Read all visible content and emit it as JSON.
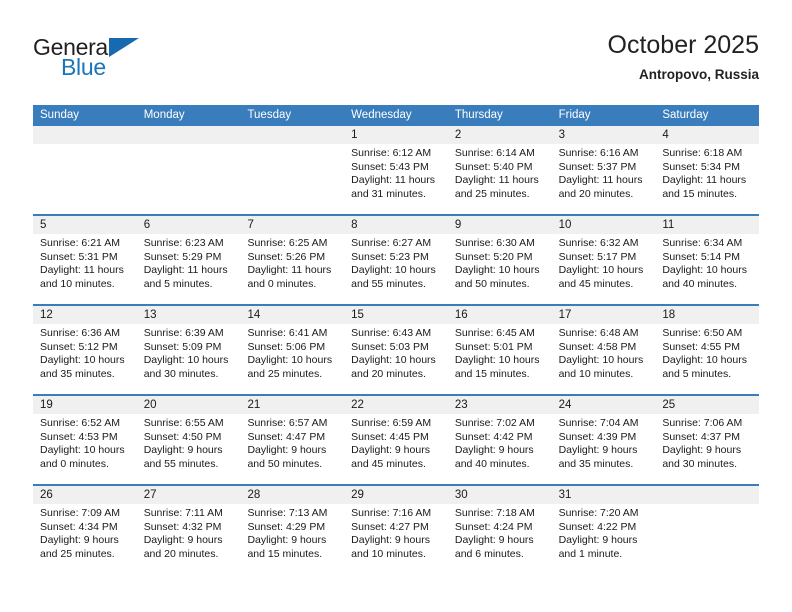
{
  "logo": {
    "text_top": "General",
    "text_bottom": "Blue",
    "triangle_color": "#1769b0",
    "blue_color": "#1b75bb"
  },
  "header": {
    "title": "October 2025",
    "subtitle": "Antropovo, Russia"
  },
  "theme": {
    "header_blue": "#3a7dbd",
    "daynum_band": "#f0f0f0"
  },
  "calendar": {
    "weekday_headers": [
      "Sunday",
      "Monday",
      "Tuesday",
      "Wednesday",
      "Thursday",
      "Friday",
      "Saturday"
    ],
    "weeks": [
      [
        {
          "day": "",
          "sunrise": "",
          "sunset": "",
          "daylight_a": "",
          "daylight_b": ""
        },
        {
          "day": "",
          "sunrise": "",
          "sunset": "",
          "daylight_a": "",
          "daylight_b": ""
        },
        {
          "day": "",
          "sunrise": "",
          "sunset": "",
          "daylight_a": "",
          "daylight_b": ""
        },
        {
          "day": "1",
          "sunrise": "Sunrise: 6:12 AM",
          "sunset": "Sunset: 5:43 PM",
          "daylight_a": "Daylight: 11 hours",
          "daylight_b": "and 31 minutes."
        },
        {
          "day": "2",
          "sunrise": "Sunrise: 6:14 AM",
          "sunset": "Sunset: 5:40 PM",
          "daylight_a": "Daylight: 11 hours",
          "daylight_b": "and 25 minutes."
        },
        {
          "day": "3",
          "sunrise": "Sunrise: 6:16 AM",
          "sunset": "Sunset: 5:37 PM",
          "daylight_a": "Daylight: 11 hours",
          "daylight_b": "and 20 minutes."
        },
        {
          "day": "4",
          "sunrise": "Sunrise: 6:18 AM",
          "sunset": "Sunset: 5:34 PM",
          "daylight_a": "Daylight: 11 hours",
          "daylight_b": "and 15 minutes."
        }
      ],
      [
        {
          "day": "5",
          "sunrise": "Sunrise: 6:21 AM",
          "sunset": "Sunset: 5:31 PM",
          "daylight_a": "Daylight: 11 hours",
          "daylight_b": "and 10 minutes."
        },
        {
          "day": "6",
          "sunrise": "Sunrise: 6:23 AM",
          "sunset": "Sunset: 5:29 PM",
          "daylight_a": "Daylight: 11 hours",
          "daylight_b": "and 5 minutes."
        },
        {
          "day": "7",
          "sunrise": "Sunrise: 6:25 AM",
          "sunset": "Sunset: 5:26 PM",
          "daylight_a": "Daylight: 11 hours",
          "daylight_b": "and 0 minutes."
        },
        {
          "day": "8",
          "sunrise": "Sunrise: 6:27 AM",
          "sunset": "Sunset: 5:23 PM",
          "daylight_a": "Daylight: 10 hours",
          "daylight_b": "and 55 minutes."
        },
        {
          "day": "9",
          "sunrise": "Sunrise: 6:30 AM",
          "sunset": "Sunset: 5:20 PM",
          "daylight_a": "Daylight: 10 hours",
          "daylight_b": "and 50 minutes."
        },
        {
          "day": "10",
          "sunrise": "Sunrise: 6:32 AM",
          "sunset": "Sunset: 5:17 PM",
          "daylight_a": "Daylight: 10 hours",
          "daylight_b": "and 45 minutes."
        },
        {
          "day": "11",
          "sunrise": "Sunrise: 6:34 AM",
          "sunset": "Sunset: 5:14 PM",
          "daylight_a": "Daylight: 10 hours",
          "daylight_b": "and 40 minutes."
        }
      ],
      [
        {
          "day": "12",
          "sunrise": "Sunrise: 6:36 AM",
          "sunset": "Sunset: 5:12 PM",
          "daylight_a": "Daylight: 10 hours",
          "daylight_b": "and 35 minutes."
        },
        {
          "day": "13",
          "sunrise": "Sunrise: 6:39 AM",
          "sunset": "Sunset: 5:09 PM",
          "daylight_a": "Daylight: 10 hours",
          "daylight_b": "and 30 minutes."
        },
        {
          "day": "14",
          "sunrise": "Sunrise: 6:41 AM",
          "sunset": "Sunset: 5:06 PM",
          "daylight_a": "Daylight: 10 hours",
          "daylight_b": "and 25 minutes."
        },
        {
          "day": "15",
          "sunrise": "Sunrise: 6:43 AM",
          "sunset": "Sunset: 5:03 PM",
          "daylight_a": "Daylight: 10 hours",
          "daylight_b": "and 20 minutes."
        },
        {
          "day": "16",
          "sunrise": "Sunrise: 6:45 AM",
          "sunset": "Sunset: 5:01 PM",
          "daylight_a": "Daylight: 10 hours",
          "daylight_b": "and 15 minutes."
        },
        {
          "day": "17",
          "sunrise": "Sunrise: 6:48 AM",
          "sunset": "Sunset: 4:58 PM",
          "daylight_a": "Daylight: 10 hours",
          "daylight_b": "and 10 minutes."
        },
        {
          "day": "18",
          "sunrise": "Sunrise: 6:50 AM",
          "sunset": "Sunset: 4:55 PM",
          "daylight_a": "Daylight: 10 hours",
          "daylight_b": "and 5 minutes."
        }
      ],
      [
        {
          "day": "19",
          "sunrise": "Sunrise: 6:52 AM",
          "sunset": "Sunset: 4:53 PM",
          "daylight_a": "Daylight: 10 hours",
          "daylight_b": "and 0 minutes."
        },
        {
          "day": "20",
          "sunrise": "Sunrise: 6:55 AM",
          "sunset": "Sunset: 4:50 PM",
          "daylight_a": "Daylight: 9 hours",
          "daylight_b": "and 55 minutes."
        },
        {
          "day": "21",
          "sunrise": "Sunrise: 6:57 AM",
          "sunset": "Sunset: 4:47 PM",
          "daylight_a": "Daylight: 9 hours",
          "daylight_b": "and 50 minutes."
        },
        {
          "day": "22",
          "sunrise": "Sunrise: 6:59 AM",
          "sunset": "Sunset: 4:45 PM",
          "daylight_a": "Daylight: 9 hours",
          "daylight_b": "and 45 minutes."
        },
        {
          "day": "23",
          "sunrise": "Sunrise: 7:02 AM",
          "sunset": "Sunset: 4:42 PM",
          "daylight_a": "Daylight: 9 hours",
          "daylight_b": "and 40 minutes."
        },
        {
          "day": "24",
          "sunrise": "Sunrise: 7:04 AM",
          "sunset": "Sunset: 4:39 PM",
          "daylight_a": "Daylight: 9 hours",
          "daylight_b": "and 35 minutes."
        },
        {
          "day": "25",
          "sunrise": "Sunrise: 7:06 AM",
          "sunset": "Sunset: 4:37 PM",
          "daylight_a": "Daylight: 9 hours",
          "daylight_b": "and 30 minutes."
        }
      ],
      [
        {
          "day": "26",
          "sunrise": "Sunrise: 7:09 AM",
          "sunset": "Sunset: 4:34 PM",
          "daylight_a": "Daylight: 9 hours",
          "daylight_b": "and 25 minutes."
        },
        {
          "day": "27",
          "sunrise": "Sunrise: 7:11 AM",
          "sunset": "Sunset: 4:32 PM",
          "daylight_a": "Daylight: 9 hours",
          "daylight_b": "and 20 minutes."
        },
        {
          "day": "28",
          "sunrise": "Sunrise: 7:13 AM",
          "sunset": "Sunset: 4:29 PM",
          "daylight_a": "Daylight: 9 hours",
          "daylight_b": "and 15 minutes."
        },
        {
          "day": "29",
          "sunrise": "Sunrise: 7:16 AM",
          "sunset": "Sunset: 4:27 PM",
          "daylight_a": "Daylight: 9 hours",
          "daylight_b": "and 10 minutes."
        },
        {
          "day": "30",
          "sunrise": "Sunrise: 7:18 AM",
          "sunset": "Sunset: 4:24 PM",
          "daylight_a": "Daylight: 9 hours",
          "daylight_b": "and 6 minutes."
        },
        {
          "day": "31",
          "sunrise": "Sunrise: 7:20 AM",
          "sunset": "Sunset: 4:22 PM",
          "daylight_a": "Daylight: 9 hours",
          "daylight_b": "and 1 minute."
        },
        {
          "day": "",
          "sunrise": "",
          "sunset": "",
          "daylight_a": "",
          "daylight_b": ""
        }
      ]
    ]
  }
}
